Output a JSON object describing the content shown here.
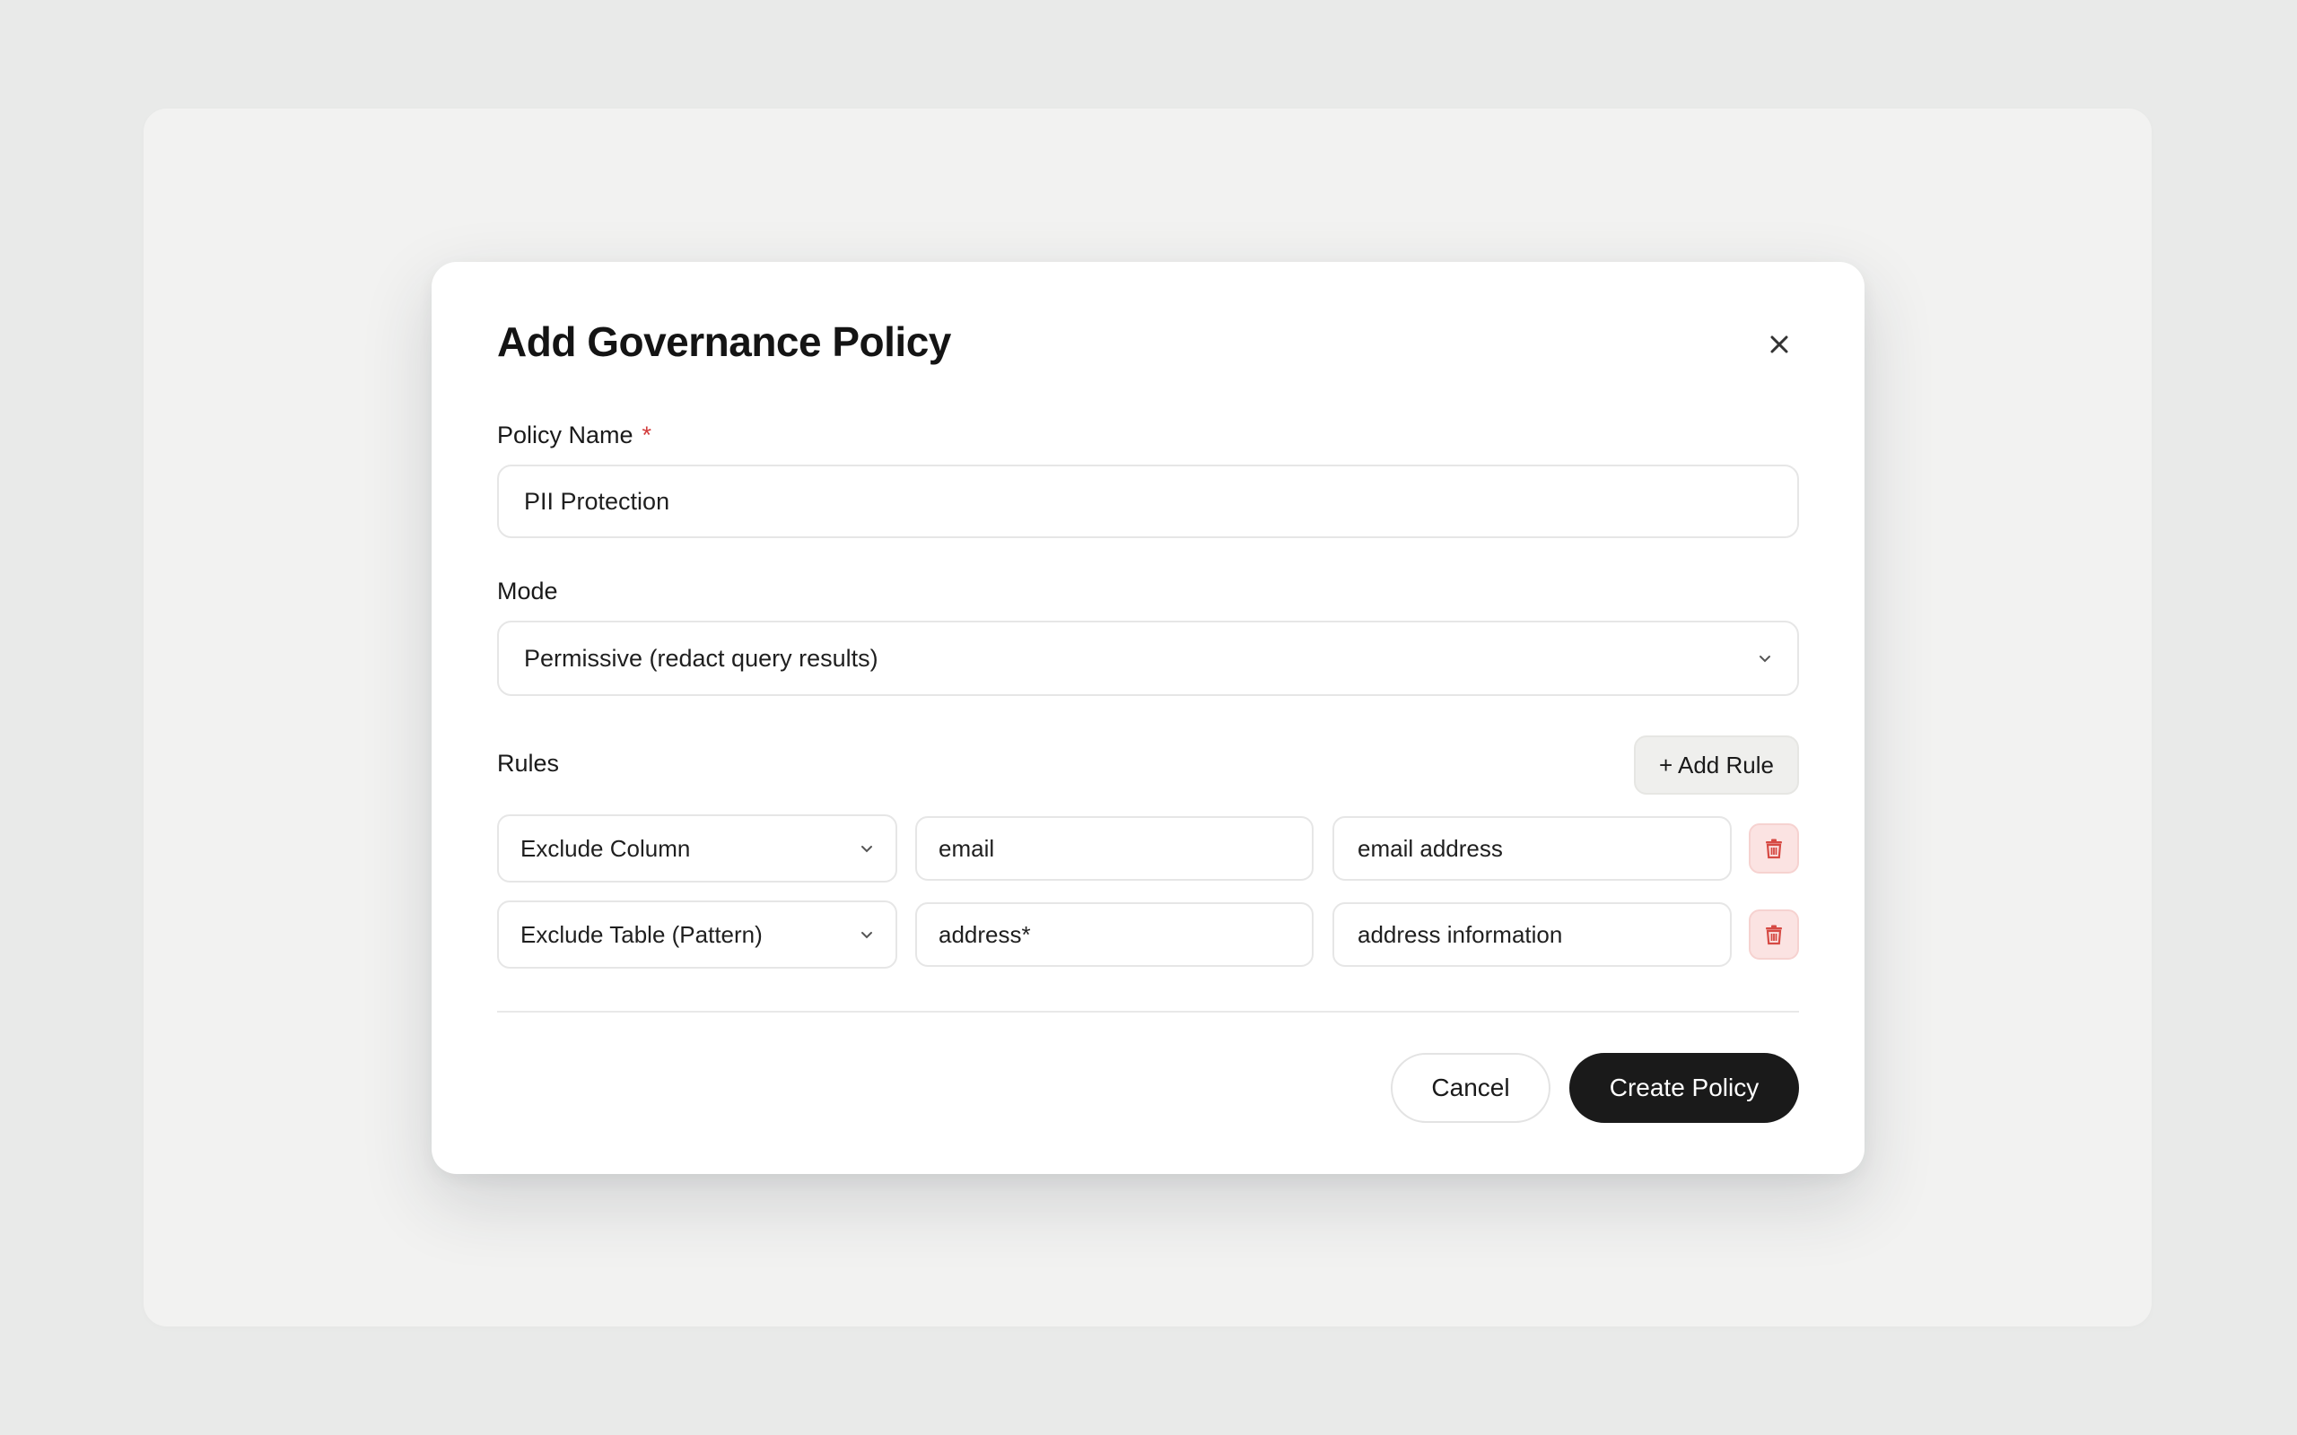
{
  "dialog": {
    "title": "Add Governance Policy",
    "close_icon": "close-icon"
  },
  "policy_name": {
    "label": "Policy Name",
    "required_marker": "*",
    "value": "PII Protection"
  },
  "mode": {
    "label": "Mode",
    "selected": "Permissive (redact query results)"
  },
  "rules": {
    "label": "Rules",
    "add_label": "+ Add Rule",
    "items": [
      {
        "type": "Exclude Column",
        "target": "email",
        "description": "email address"
      },
      {
        "type": "Exclude Table (Pattern)",
        "target": "address*",
        "description": "address information"
      }
    ]
  },
  "footer": {
    "cancel_label": "Cancel",
    "create_label": "Create Policy"
  },
  "colors": {
    "primary_button": "#1a1a1a",
    "required": "#d23b3b",
    "delete_icon": "#d64a44",
    "delete_bg": "#fbe3e2"
  }
}
